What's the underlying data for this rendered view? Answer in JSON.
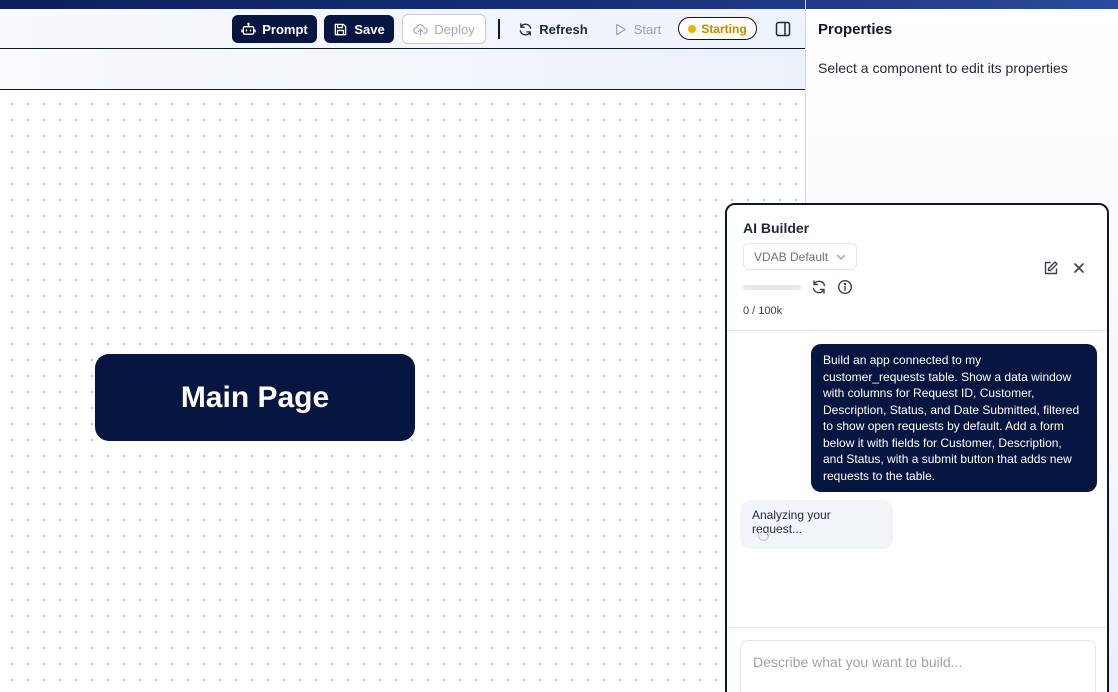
{
  "toolbar": {
    "prompt_label": "Prompt",
    "save_label": "Save",
    "deploy_label": "Deploy",
    "refresh_label": "Refresh",
    "start_label": "Start",
    "status_label": "Starting"
  },
  "canvas": {
    "node_label": "Main Page"
  },
  "properties": {
    "title": "Properties",
    "hint": "Select a component to edit its properties"
  },
  "ai_builder": {
    "title": "AI Builder",
    "model": "VDAB Default",
    "usage": "0 / 100k",
    "usage_fraction": 0,
    "messages": [
      {
        "role": "user",
        "text": "Build an app connected to my customer_requests table. Show a data window with columns for Request ID, Customer, Description, Status, and Date Submitted, filtered to show open requests by default. Add a form below it with fields for Customer, Description, and Status, with a submit button that adds new requests to the table."
      },
      {
        "role": "assistant",
        "text": "Analyzing your request..."
      }
    ],
    "input_placeholder": "Describe what you want to build..."
  },
  "colors": {
    "primary": "#061640",
    "status": "#eab308",
    "canvas_dot": "#b8bdc7"
  },
  "icons": [
    "robot-icon",
    "save-icon",
    "cloud-upload-icon",
    "refresh-icon",
    "play-icon",
    "panel-toggle-icon",
    "chevron-down-icon",
    "sync-icon",
    "info-icon",
    "edit-icon",
    "close-icon"
  ]
}
